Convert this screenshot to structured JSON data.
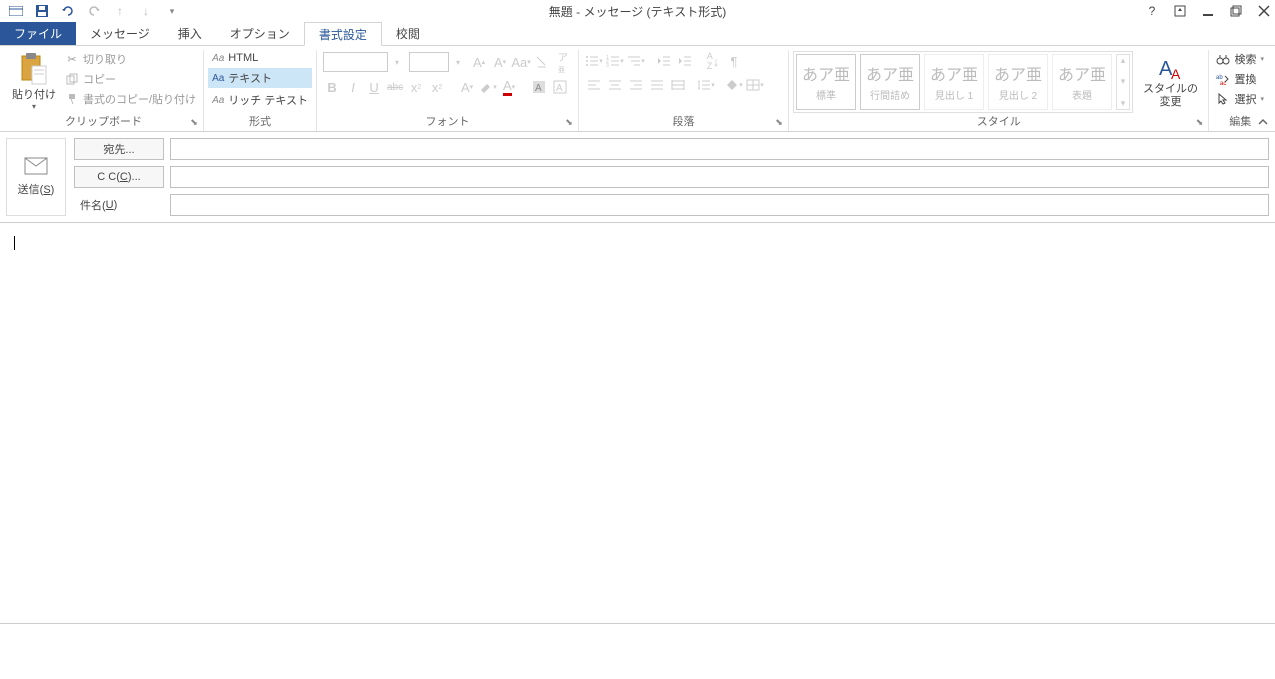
{
  "title": "無題 - メッセージ (テキスト形式)",
  "tabs": {
    "file": "ファイル",
    "message": "メッセージ",
    "insert": "挿入",
    "options": "オプション",
    "format": "書式設定",
    "review": "校閲"
  },
  "groups": {
    "clipboard": {
      "label": "クリップボード",
      "paste": "貼り付け",
      "cut": "切り取り",
      "copy": "コピー",
      "format_painter": "書式のコピー/貼り付け"
    },
    "format": {
      "label": "形式",
      "html": "HTML",
      "text": "テキスト",
      "rich": "リッチ テキスト"
    },
    "font": {
      "label": "フォント"
    },
    "paragraph": {
      "label": "段落"
    },
    "styles": {
      "label": "スタイル",
      "change_styles": "スタイルの\n変更",
      "items": [
        {
          "preview": "あア亜",
          "name": "標準"
        },
        {
          "preview": "あア亜",
          "name": "行間詰め"
        },
        {
          "preview": "あア亜",
          "name": "見出し 1"
        },
        {
          "preview": "あア亜",
          "name": "見出し 2"
        },
        {
          "preview": "あア亜",
          "name": "表題"
        }
      ]
    },
    "editing": {
      "label": "編集",
      "find": "検索",
      "replace": "置換",
      "select": "選択"
    }
  },
  "envelope": {
    "send": "送信(S)",
    "to": "宛先...",
    "cc": "C C(C)...",
    "subject": "件名(U)"
  }
}
